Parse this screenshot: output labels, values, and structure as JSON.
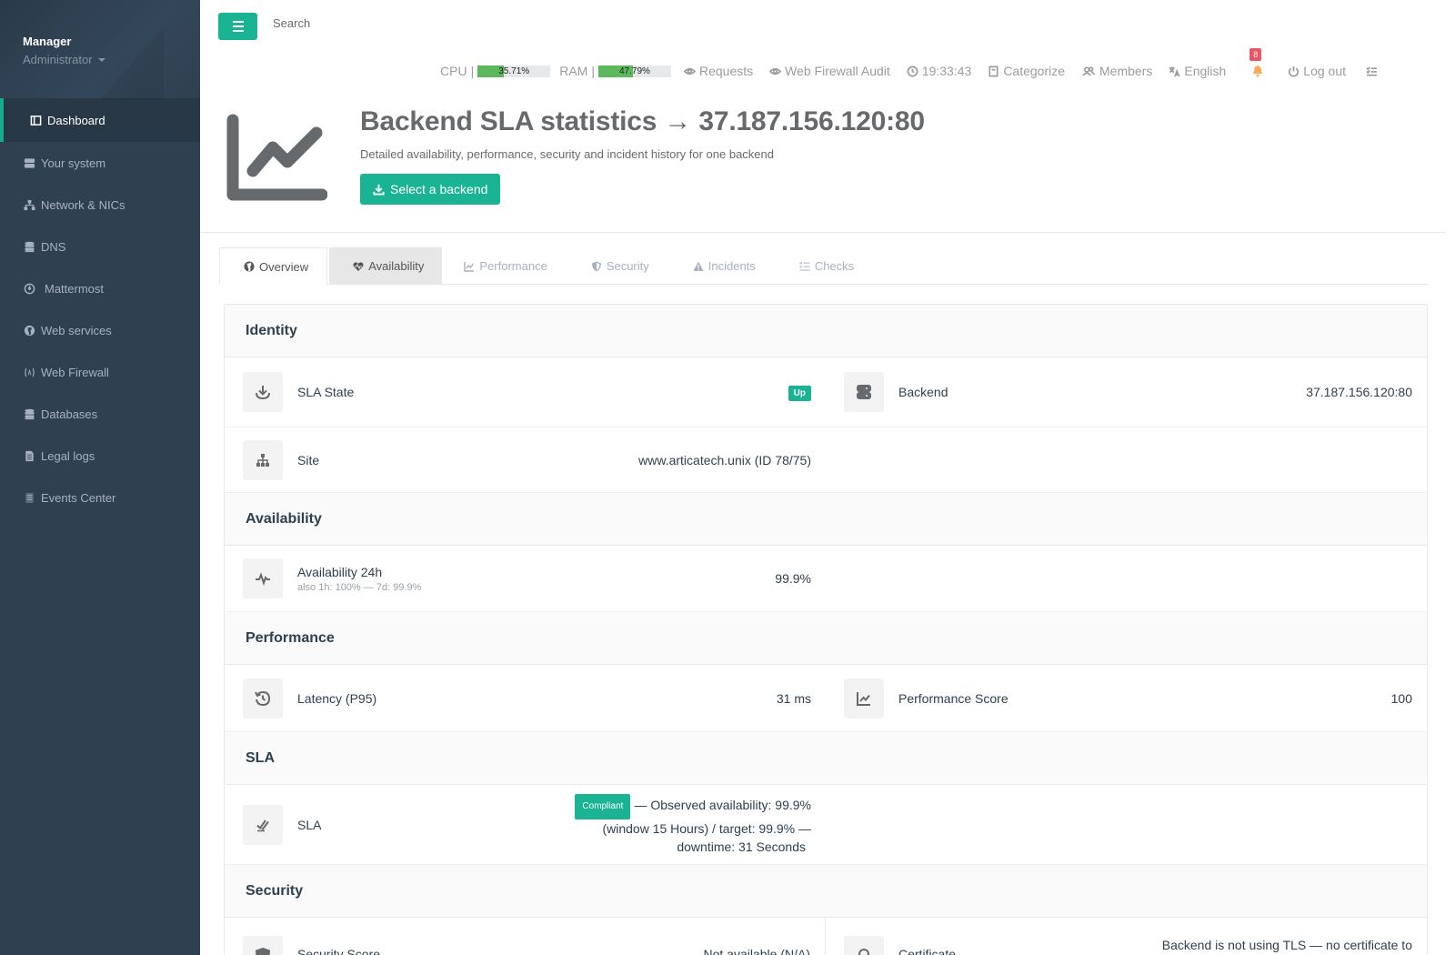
{
  "sidebar": {
    "profile_name": "Manager",
    "profile_role": "Administrator",
    "items": [
      {
        "label": "Dashboard",
        "icon": "dashboard-icon"
      },
      {
        "label": "Your system",
        "icon": "server-icon"
      },
      {
        "label": "Network & NICs",
        "icon": "network-icon"
      },
      {
        "label": "DNS",
        "icon": "database-icon"
      },
      {
        "label": "Mattermost",
        "icon": "mattermost-icon"
      },
      {
        "label": "Web services",
        "icon": "globe-icon"
      },
      {
        "label": "Web Firewall",
        "icon": "firewall-icon"
      },
      {
        "label": "Databases",
        "icon": "database-icon"
      },
      {
        "label": "Legal logs",
        "icon": "file-icon"
      },
      {
        "label": "Events Center",
        "icon": "list-icon"
      }
    ]
  },
  "topbar": {
    "search_placeholder": "Search",
    "cpu_label": "CPU",
    "cpu_value": "35.71%",
    "cpu_fraction": 0.3571,
    "ram_label": "RAM",
    "ram_value": "47.79%",
    "ram_fraction": 0.4779,
    "separator": "|",
    "requests": "Requests",
    "waf_audit": "Web Firewall Audit",
    "clock": "19:33:43",
    "categorize": "Categorize",
    "members": "Members",
    "language": "English",
    "notifications_count": "8",
    "logout": "Log out"
  },
  "header": {
    "title": "Backend SLA statistics → 37.187.156.120:80",
    "subtitle": "Detailed availability, performance, security and incident history for one backend",
    "select_button": "Select a backend"
  },
  "tabs": [
    {
      "label": "Overview",
      "icon": "globe-icon"
    },
    {
      "label": "Availability",
      "icon": "heartbeat-icon"
    },
    {
      "label": "Performance",
      "icon": "line-chart-icon"
    },
    {
      "label": "Security",
      "icon": "shield-icon"
    },
    {
      "label": "Incidents",
      "icon": "warning-icon"
    },
    {
      "label": "Checks",
      "icon": "checklist-icon"
    }
  ],
  "sections": {
    "identity": {
      "title": "Identity",
      "sla_state_label": "SLA State",
      "sla_state_value": "Up",
      "backend_label": "Backend",
      "backend_value": "37.187.156.120:80",
      "site_label": "Site",
      "site_value": "www.articatech.unix (ID 78/75)"
    },
    "availability": {
      "title": "Availability",
      "avail_label": "Availability 24h",
      "avail_sub": "also 1h: 100% — 7d: 99.9%",
      "avail_value": "99.9%"
    },
    "performance": {
      "title": "Performance",
      "latency_label": "Latency (P95)",
      "latency_value": "31 ms",
      "score_label": "Performance Score",
      "score_value": "100"
    },
    "sla": {
      "title": "SLA",
      "sla_label": "SLA",
      "badge": "Compliant",
      "line1": "— Observed availability: 99.9%",
      "line2": "(window 15 Hours) / target: 99.9% —",
      "line3": "downtime: 31 Seconds"
    },
    "security": {
      "title": "Security",
      "score_label": "Security Score",
      "score_value": "Not available (N/A)",
      "cert_label": "Certificate",
      "cert_value": "Backend is not using TLS — no certificate to"
    }
  },
  "colors": {
    "sidebar_bg": "#2f4050",
    "accent": "#1ab394",
    "meter_fill": "#5cb85c",
    "badge_red": "#ed5565"
  }
}
